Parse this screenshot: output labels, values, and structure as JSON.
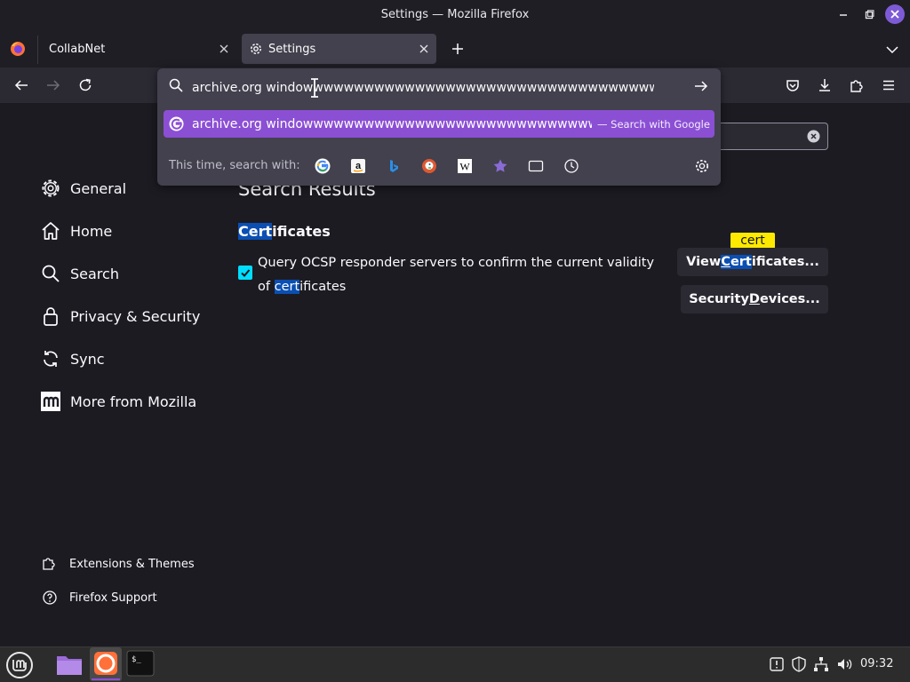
{
  "window": {
    "title": "Settings — Mozilla Firefox"
  },
  "tabs": [
    {
      "label": "CollabNet"
    },
    {
      "label": "Settings"
    }
  ],
  "urlbar": {
    "value": "archive.org windowwwwwwwwwwwwwwwwwwwwwwwwwwwwwwwwwwwwwwwwwwwww",
    "suggestion": "archive.org windowwwwwwwwwwwwwwwwwwwwwwwwwwwwwwwwwwwwwwwwwwwww",
    "suggestion_action": "— Search with Google",
    "this_time_label": "This time, search with:",
    "engines": [
      "google-icon",
      "amazon-icon",
      "bing-icon",
      "duckduckgo-icon",
      "wikipedia-icon",
      "bookmarks-icon",
      "tabs-icon",
      "history-icon"
    ]
  },
  "sidebar": {
    "items": [
      {
        "label": "General",
        "icon": "gear-icon"
      },
      {
        "label": "Home",
        "icon": "home-icon"
      },
      {
        "label": "Search",
        "icon": "search-icon"
      },
      {
        "label": "Privacy & Security",
        "icon": "lock-icon"
      },
      {
        "label": "Sync",
        "icon": "sync-icon"
      },
      {
        "label": "More from Mozilla",
        "icon": "mozilla-icon"
      }
    ],
    "footer": [
      {
        "label": "Extensions & Themes",
        "icon": "puzzle-icon"
      },
      {
        "label": "Firefox Support",
        "icon": "help-icon"
      }
    ]
  },
  "content": {
    "title": "Search Results",
    "section": {
      "heading_hl": "Cert",
      "heading_rest": "ificates"
    },
    "ocsp": {
      "pre": "Query OCSP responder servers to confirm the current validity of ",
      "hl": "cert",
      "post": "ificates",
      "checked": true
    },
    "view_cert": {
      "pre": "View ",
      "u": "C",
      "hl_rest": "ert",
      "post": "ificates..."
    },
    "security_devices": {
      "pre": "Security ",
      "u": "D",
      "post": "evices..."
    },
    "tooltip": "cert"
  },
  "taskbar": {
    "clock": "09:32"
  },
  "colors": {
    "accent": "#8b4fd4",
    "checkbox": "#00ddff",
    "highlight": "#0b4fb2",
    "tooltip": "#ffe900"
  }
}
